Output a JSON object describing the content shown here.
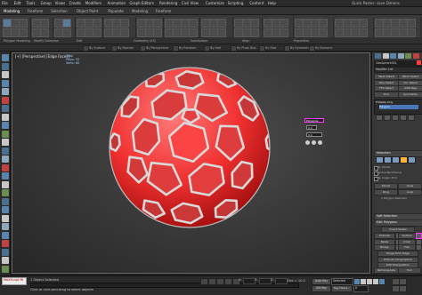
{
  "menubar": {
    "items": [
      "File",
      "Edit",
      "Tools",
      "Group",
      "Views",
      "Create",
      "Modifiers",
      "Animation",
      "Graph Editors",
      "Rendering",
      "Civil View",
      "Customize",
      "Scripting",
      "Content",
      "Help"
    ],
    "search": "Quick Pastes: save Dimens"
  },
  "ribbon": {
    "tabs": [
      "Modeling",
      "Freeform",
      "Selection",
      "Object Paint",
      "Populate",
      "Modeling",
      "Freeform"
    ],
    "active_tab_index": 0,
    "footer_labels": [
      "Polygon Modeling",
      "Modify Selection",
      "Edit",
      "Geometry (All)",
      "Subdivision",
      "Align",
      "Properties"
    ],
    "strip_labels": [
      "By Surface",
      "By Normal",
      "By Perspective",
      "By Random",
      "By Half",
      "By Pivot Dist",
      "By Size",
      "By Symmetry",
      "By Numeric"
    ]
  },
  "viewport": {
    "label": "[+] [Perspective] [Edge Faces]",
    "stats": [
      "Total",
      "Polys: 32",
      "Verts: 60"
    ],
    "caddy": {
      "title": "Polygons",
      "value": "0.0",
      "value2": "0.0"
    },
    "object_color": "#ff3a3a",
    "seam_color": "#d9d9d9"
  },
  "command_panel": {
    "object_name": "GeoSphere001",
    "modifier_list": "Modifier List",
    "buttons": [
      [
        "Mesh Select",
        "Patch Select"
      ],
      [
        "Poly Select",
        "Vol. Select"
      ],
      [
        "FFD Select",
        "UVW Map"
      ],
      [
        "Turn",
        "Symmetry"
      ]
    ],
    "stack": [
      "Editable Poly",
      "Polygon"
    ],
    "rollouts": {
      "selection": "Selection",
      "soft_selection": "Soft Selection",
      "edit_polygons": "Edit Polygons",
      "edit_geometry": "Edit Geometry"
    },
    "selection_opts": [
      "By Vertex",
      "Ignore Backfacing",
      "By Angle: 45.0",
      "Shrink",
      "Grow",
      "Ring",
      "Loop"
    ],
    "selected_text": "1 Polygon Selected",
    "edit_poly_buttons": [
      "Insert Vertex",
      "Extrude",
      "Outline",
      "Bevel",
      "Inset",
      "Bridge",
      "Flip",
      "Hinge From Edge",
      "Extrude Along Spline",
      "Edit Triangulation",
      "Retriangulate",
      "Turn"
    ]
  },
  "statusbar": {
    "maxscript": "MAXScript Mi",
    "selection": "1 Object Selected",
    "prompt": "Click or click-and-drag to select objects",
    "coords": [
      "X: ",
      "Y: ",
      "Z: "
    ],
    "grid": "Grid = 10.0",
    "autokey": "Auto Key",
    "selected": "Selected",
    "setkey": "Set Key",
    "keyfilters": "Key Filters...",
    "frame": "0"
  }
}
